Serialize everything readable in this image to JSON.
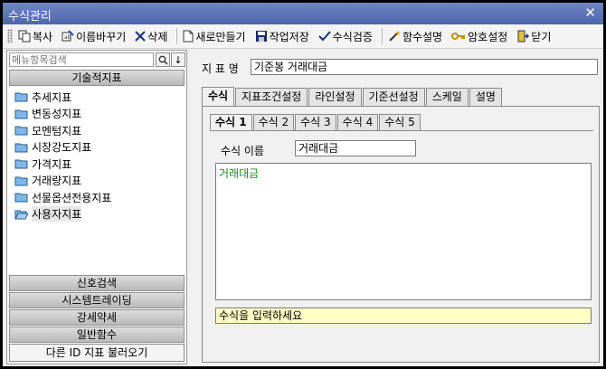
{
  "window": {
    "title": "수식관리",
    "close_glyph": "✕"
  },
  "toolbar": {
    "copy": "복사",
    "rename": "이름바꾸기",
    "delete": "삭제",
    "new": "새로만들기",
    "save": "작업저장",
    "verify": "수식검증",
    "func_help": "함수설명",
    "password": "암호설정",
    "close": "닫기"
  },
  "left_panel": {
    "search_placeholder": "메뉴항목검색",
    "search_icon": "magnifier-icon",
    "down_icon": "↓",
    "categories": {
      "technical": "기술적지표",
      "signal": "신호검색",
      "system": "시스템트레이딩",
      "strength": "강세약세",
      "general": "일반함수"
    },
    "tree_items": [
      {
        "label": "추세지표"
      },
      {
        "label": "변동성지표"
      },
      {
        "label": "모멘텀지표"
      },
      {
        "label": "시장강도지표"
      },
      {
        "label": "가격지표"
      },
      {
        "label": "거래량지표"
      },
      {
        "label": "선물옵션전용지표"
      },
      {
        "label": "사용자지표"
      }
    ],
    "load_button": "다른 ID 지표 불러오기"
  },
  "right_panel": {
    "indicator_label": "지 표 명",
    "indicator_name": "기준봉 거래대금",
    "tabs": [
      "수식",
      "지표조건설정",
      "라인설정",
      "기준선설정",
      "스케일",
      "설명"
    ],
    "formula_tabs": [
      "수식 1",
      "수식 2",
      "수식 3",
      "수식 4",
      "수식 5"
    ],
    "formula_name_label": "수식 이름",
    "formula_name": "거래대금",
    "formula_text": "거래대금",
    "hint": "수식을 입력하세요"
  },
  "colors": {
    "titlebar": "#5a72b8",
    "formula_text": "#1a8c1a",
    "hint_bg": "#ffffc4"
  }
}
